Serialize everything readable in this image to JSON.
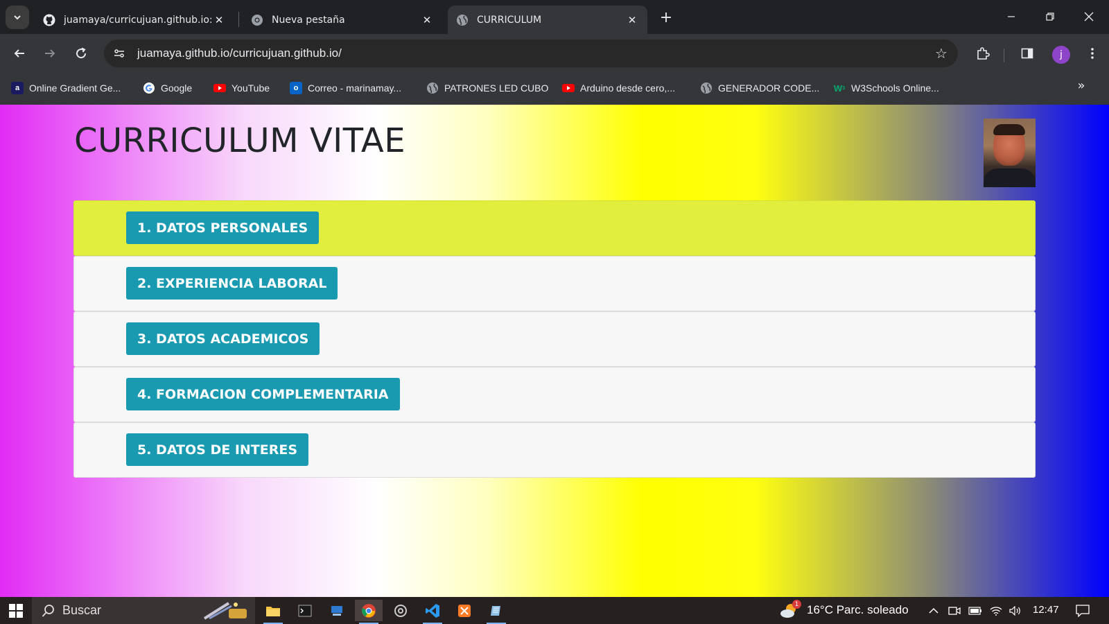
{
  "browser": {
    "tabs": [
      {
        "title": "juamaya/curricujuan.github.io: c",
        "favicon": "github-icon",
        "active": false
      },
      {
        "title": "Nueva pestaña",
        "favicon": "chrome-icon",
        "active": false
      },
      {
        "title": "CURRICULUM",
        "favicon": "globe-icon",
        "active": true
      }
    ],
    "url": "juamaya.github.io/curricujuan.github.io/",
    "avatar_letter": "j",
    "bookmarks": [
      {
        "label": "Online Gradient Ge...",
        "icon": "a-icon"
      },
      {
        "label": "Google",
        "icon": "google-icon"
      },
      {
        "label": "YouTube",
        "icon": "youtube-icon"
      },
      {
        "label": "Correo - marinamay...",
        "icon": "outlook-icon"
      },
      {
        "label": "PATRONES LED CUBO",
        "icon": "globe-icon"
      },
      {
        "label": "Arduino desde cero,...",
        "icon": "youtube-icon"
      },
      {
        "label": "GENERADOR CODE...",
        "icon": "globe-icon"
      },
      {
        "label": "W3Schools Online...",
        "icon": "w3schools-icon"
      }
    ]
  },
  "page": {
    "title": "CURRICULUM VITAE",
    "sections": [
      {
        "label": "1. DATOS PERSONALES",
        "active": true
      },
      {
        "label": "2. EXPERIENCIA LABORAL",
        "active": false
      },
      {
        "label": "3. DATOS ACADEMICOS",
        "active": false
      },
      {
        "label": "4. FORMACION COMPLEMENTARIA",
        "active": false
      },
      {
        "label": "5. DATOS DE INTERES",
        "active": false
      }
    ]
  },
  "taskbar": {
    "search_placeholder": "Buscar",
    "weather_badge": "1",
    "weather": "16°C  Parc. soleado",
    "time": "12:47"
  },
  "colors": {
    "section_button": "#1a9ab0",
    "active_section": "#e1ee3e"
  }
}
